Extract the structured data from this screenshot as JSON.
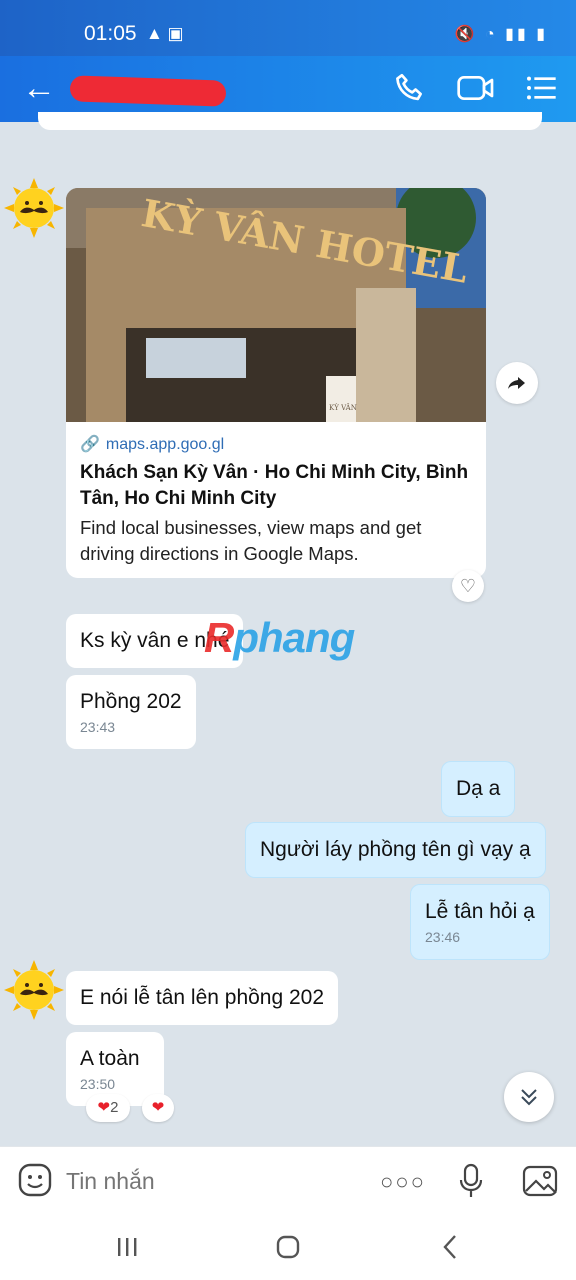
{
  "status_bar": {
    "time": "01:05"
  },
  "card": {
    "url": "maps.app.goo.gl",
    "title": "Khách Sạn Kỳ Vân · Ho Chi Minh City, Bình Tân, Ho Chi Minh City",
    "description": "Find local businesses, view maps and get driving directions in Google Maps.",
    "photo_sign": "KỲ VÂN HOTEL",
    "photo_logo_text": "KỲ VÂN"
  },
  "messages": [
    {
      "text": "Ks kỳ vân e nhé",
      "time": ""
    },
    {
      "text": "Phồng 202",
      "time": "23:43"
    },
    {
      "text": "Dạ a",
      "time": ""
    },
    {
      "text": "Người láy phồng tên gì vạy ạ",
      "time": ""
    },
    {
      "text": "Lễ tân hỏi ạ",
      "time": "23:46"
    },
    {
      "text": "E nói lễ tân lên phồng 202",
      "time": ""
    },
    {
      "text": "A toàn",
      "time": "23:50"
    }
  ],
  "reactions": {
    "heart_count": "2"
  },
  "watermark": {
    "r": "R",
    "rest": "phang"
  },
  "composer": {
    "placeholder": "Tin nhắn"
  },
  "icons": [
    "back-arrow-icon",
    "phone-icon",
    "video-call-icon",
    "list-menu-icon",
    "share-arrow-icon",
    "heart-icon",
    "chevron-double-down-icon",
    "emoji-icon",
    "more-dots-icon",
    "microphone-icon",
    "image-icon"
  ],
  "colors": {
    "header": "#1f8ae9",
    "my_bubble": "#d5efff",
    "their_bubble": "#ffffff",
    "background": "#dbe3ea"
  }
}
